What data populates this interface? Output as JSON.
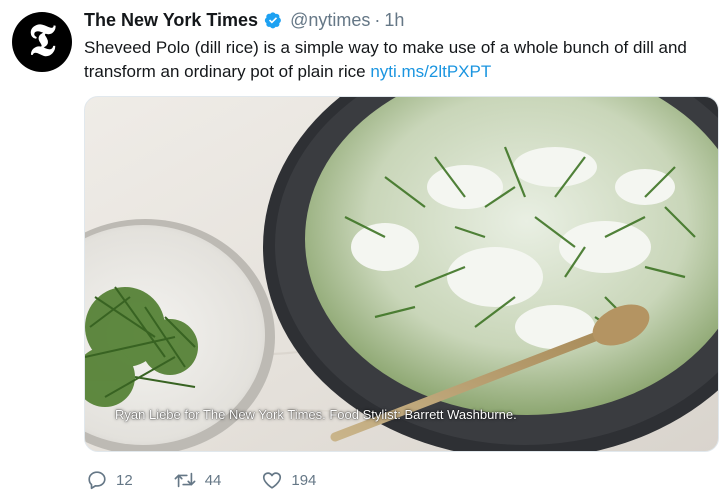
{
  "tweet": {
    "author": {
      "display_name": "The New York Times",
      "handle": "@nytimes",
      "avatar_glyph": "𝕿",
      "verified": true
    },
    "separator": "·",
    "timestamp": "1h",
    "text": "Sheveed Polo (dill rice) is a simple way to make use of a whole bunch of dill and transform an ordinary pot of plain rice",
    "link": "nyti.ms/2ltPXPT",
    "media": {
      "caption": "Ryan Liebe for The New York Times. Food Stylist: Barrett Washburne."
    },
    "actions": {
      "replies": "12",
      "retweets": "44",
      "likes": "194"
    }
  },
  "colors": {
    "link": "#1b95e0",
    "verified": "#1da1f2",
    "muted": "#657786"
  }
}
